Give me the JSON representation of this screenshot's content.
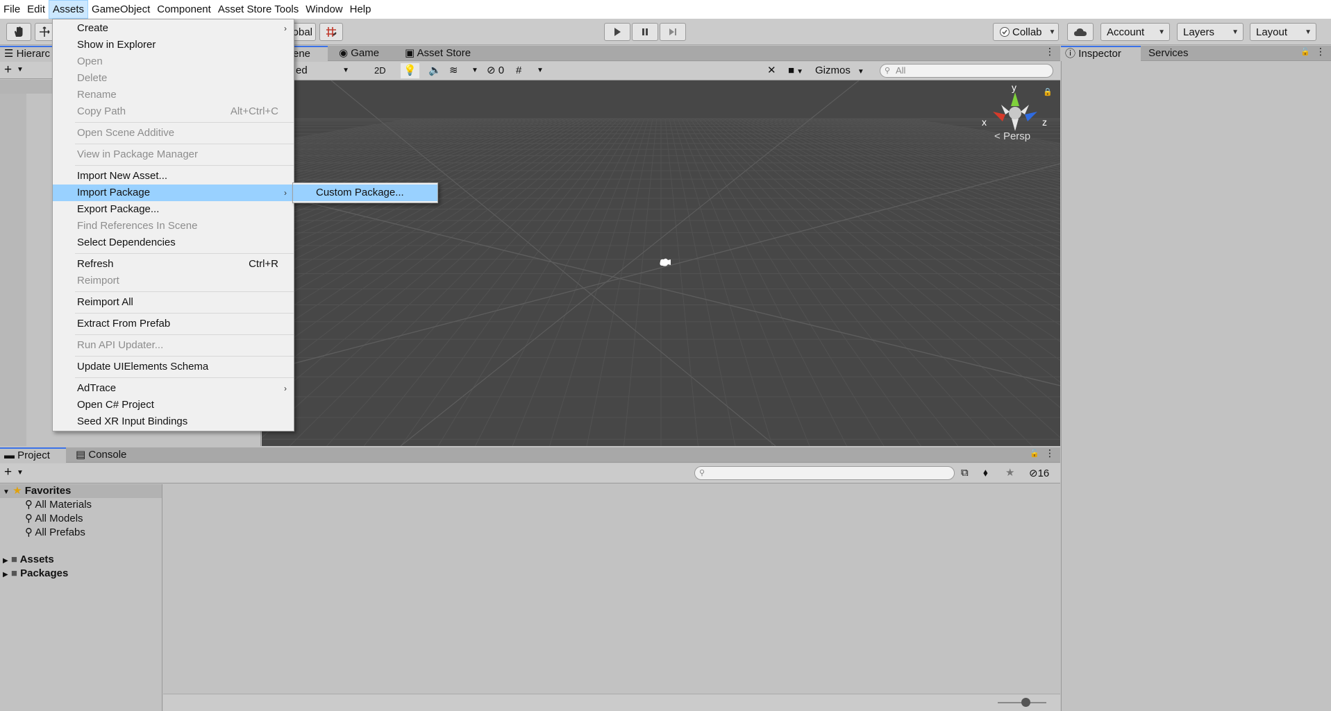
{
  "menubar": {
    "items": [
      "File",
      "Edit",
      "Assets",
      "GameObject",
      "Component",
      "Asset Store Tools",
      "Window",
      "Help"
    ],
    "active": "Assets"
  },
  "toolbar": {
    "pivot_partial": "obal",
    "collab": "Collab",
    "account": "Account",
    "layers": "Layers",
    "layout": "Layout"
  },
  "hierarchy": {
    "tab_label": "Hierarc"
  },
  "scene": {
    "tabs": {
      "scene": "ene",
      "game": "Game",
      "asset_store": "Asset Store"
    },
    "shading_partial": "ed",
    "mode_2d": "2D",
    "hidden_count": "0",
    "gizmos": "Gizmos",
    "search_placeholder": "All",
    "persp": "Persp",
    "axis_x": "x",
    "axis_y": "y",
    "axis_z": "z"
  },
  "inspector": {
    "tabs": [
      "Inspector",
      "Services"
    ]
  },
  "project": {
    "tabs": [
      "Project",
      "Console"
    ],
    "favorites": "Favorites",
    "favorite_items": [
      "All Materials",
      "All Models",
      "All Prefabs"
    ],
    "folders": [
      "Assets",
      "Packages"
    ],
    "hidden_count": "16"
  },
  "assets_menu": {
    "items": [
      {
        "label": "Create",
        "submenu": true
      },
      {
        "label": "Show in Explorer"
      },
      {
        "label": "Open",
        "disabled": true
      },
      {
        "label": "Delete",
        "disabled": true
      },
      {
        "label": "Rename",
        "disabled": true
      },
      {
        "label": "Copy Path",
        "shortcut": "Alt+Ctrl+C",
        "disabled": true
      },
      {
        "sep": true
      },
      {
        "label": "Open Scene Additive",
        "disabled": true
      },
      {
        "sep": true
      },
      {
        "label": "View in Package Manager",
        "disabled": true
      },
      {
        "sep": true
      },
      {
        "label": "Import New Asset..."
      },
      {
        "label": "Import Package",
        "submenu": true,
        "highlight": true
      },
      {
        "label": "Export Package..."
      },
      {
        "label": "Find References In Scene",
        "disabled": true
      },
      {
        "label": "Select Dependencies"
      },
      {
        "sep": true
      },
      {
        "label": "Refresh",
        "shortcut": "Ctrl+R"
      },
      {
        "label": "Reimport",
        "disabled": true
      },
      {
        "sep": true
      },
      {
        "label": "Reimport All"
      },
      {
        "sep": true
      },
      {
        "label": "Extract From Prefab"
      },
      {
        "sep": true
      },
      {
        "label": "Run API Updater...",
        "disabled": true
      },
      {
        "sep": true
      },
      {
        "label": "Update UIElements Schema"
      },
      {
        "sep": true
      },
      {
        "label": "AdTrace",
        "submenu": true
      },
      {
        "label": "Open C# Project"
      },
      {
        "label": "Seed XR Input Bindings"
      }
    ]
  },
  "import_submenu": {
    "items": [
      "Custom Package..."
    ]
  },
  "colors": {
    "highlight": "#99d1ff",
    "accent": "#3a72e8",
    "scene_bg": "#474747"
  }
}
